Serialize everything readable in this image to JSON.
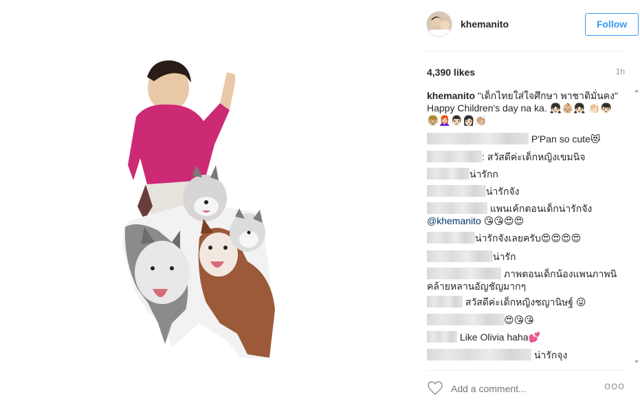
{
  "post": {
    "username": "khemanito",
    "follow_label": "Follow",
    "likes": "4,390 likes",
    "time": "1h",
    "caption_user": "khemanito",
    "caption_text": " \"เด็กไทยใส่ใจศึกษา พาชาติมั่นคง\" Happy Children's day na ka. 👧🏻👶🏼👧🏻 👏🏻👦🏻👦🏼👩🏻‍🦰👨🏻‍👩🏻👏🏼"
  },
  "comments": [
    {
      "text": "P'Pan so cute😻"
    },
    {
      "text": ": สวัสดีค่ะเด็กหญิงเขมนิจ"
    },
    {
      "text": "น่ารักก"
    },
    {
      "text": "น่ารักจัง"
    },
    {
      "text": "แพนเค้กตอนเด็กน่ารักจัง",
      "mention": "@khemanito",
      "after": " 😘😘😍😍"
    },
    {
      "text": "น่ารักจังเลยครับ😍😍😍😍"
    },
    {
      "text": "น่ารัก"
    },
    {
      "text": "ภาพตอนเด็กน้องแพนภาพนิคล้ายหลานอัญชัญมากๆ"
    },
    {
      "text": "สวัสดีค่ะเด็กหญิงชญานิษฐ์ 😜"
    },
    {
      "text": "😍😘😘"
    },
    {
      "text": "Like Olivia haha💕"
    },
    {
      "text": "น่ารักจุง"
    }
  ],
  "footer": {
    "comment_placeholder": "Add a comment...",
    "more": "ooo"
  }
}
